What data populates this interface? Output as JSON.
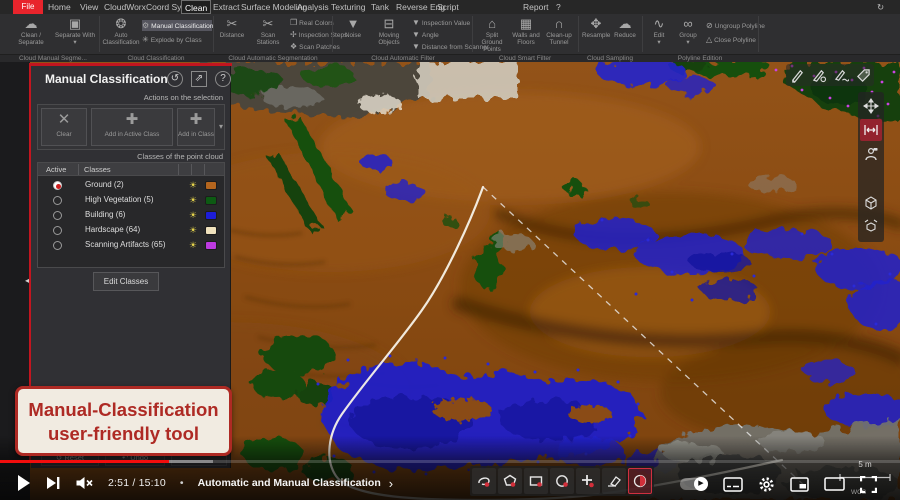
{
  "menu": {
    "file_label": "File",
    "tabs": [
      "Home",
      "View",
      "CloudWorx",
      "Coord Sys",
      "Clean",
      "Extract",
      "Surface Modeling",
      "Analysis",
      "Texturing",
      "Tank",
      "Reverse Eng",
      "Script"
    ],
    "active_tab": "Clean",
    "report_label": "Report",
    "help_label": "?",
    "sync_glyph": "↻"
  },
  "ribbon": {
    "groups": [
      {
        "label": "Cloud Manual Segme...",
        "big": [
          {
            "label": "Clean / Separate",
            "glyph": "☁"
          },
          {
            "label": "Separate With",
            "glyph": "▣",
            "caret": "▾"
          }
        ]
      },
      {
        "label": "Cloud Classification",
        "big": [
          {
            "label": "Auto Classification",
            "glyph": "❂"
          }
        ],
        "small": [
          {
            "label": "Manual Classification",
            "glyph": "⚙"
          },
          {
            "label": "Explode by Class",
            "glyph": "✳"
          }
        ]
      },
      {
        "label": "Cloud Automatic Segmentation",
        "big": [
          {
            "label": "Distance",
            "glyph": "✂"
          },
          {
            "label": "Scan Stations",
            "glyph": "✂"
          }
        ],
        "small": [
          {
            "label": "Real Colors",
            "glyph": "❒"
          },
          {
            "label": "Inspection Steps",
            "glyph": "✢"
          },
          {
            "label": "Scan Patches",
            "glyph": "❖"
          }
        ]
      },
      {
        "label": "Cloud Automatic Filter",
        "big": [
          {
            "label": "Noise",
            "glyph": "▼"
          },
          {
            "label": "Moving Objects",
            "glyph": "⊟"
          }
        ],
        "small": [
          {
            "label": "Inspection Value",
            "glyph": "▼"
          },
          {
            "label": "Angle",
            "glyph": "▼"
          },
          {
            "label": "Distance from Scanner",
            "glyph": "▼"
          }
        ]
      },
      {
        "label": "Cloud Smart Filter",
        "big": [
          {
            "label": "Split Ground Points",
            "glyph": "⌂"
          },
          {
            "label": "Walls and Floors",
            "glyph": "▦"
          },
          {
            "label": "Clean-up Tunnel",
            "glyph": "∩"
          }
        ]
      },
      {
        "label": "Cloud Sampling",
        "big": [
          {
            "label": "Resample",
            "glyph": "✥"
          },
          {
            "label": "Reduce",
            "glyph": "☁"
          }
        ]
      },
      {
        "label": "Polyline Edition",
        "big": [
          {
            "label": "Edit",
            "glyph": "∿",
            "caret": "▾"
          },
          {
            "label": "Group",
            "glyph": "∞",
            "caret": "▾"
          }
        ],
        "small": [
          {
            "label": "Ungroup Polyline",
            "glyph": "⊘"
          },
          {
            "label": "Close Polyline",
            "glyph": "△"
          }
        ]
      }
    ]
  },
  "panel": {
    "title": "Manual Classification",
    "header_icons": {
      "history": "↺",
      "undock": "⇗",
      "help": "?"
    },
    "actions_label": "Actions on the selection",
    "actions": [
      {
        "label": "Clear",
        "glyph": "✕"
      },
      {
        "label": "Add in Active Class",
        "glyph": "✚"
      },
      {
        "label": "Add in Class",
        "glyph": "✚",
        "caret": "▾"
      }
    ],
    "classes_label": "Classes of the point cloud",
    "table": {
      "headers": [
        "Active",
        "Classes"
      ],
      "bulb_glyph": "☀",
      "rows": [
        {
          "label": "Ground (2)",
          "color": "#b4651e",
          "selected": true
        },
        {
          "label": "High Vegetation (5)",
          "color": "#0d5a13"
        },
        {
          "label": "Building (6)",
          "color": "#1d1dd8"
        },
        {
          "label": "Hardscape (64)",
          "color": "#f0e2bd"
        },
        {
          "label": "Scanning Artifacts (65)",
          "color": "#bd3ae0"
        }
      ]
    },
    "edit_button": "Edit Classes",
    "bottom_buttons": [
      {
        "label": "Reset",
        "glyph": "↺"
      },
      {
        "label": "Undo",
        "glyph": "↶"
      },
      {
        "label": "",
        "glyph": ""
      }
    ]
  },
  "caption": {
    "line1": "Manual-Classification",
    "line2": "user-friendly tool"
  },
  "viewport": {
    "scale_label": "5 m",
    "coord_label": "WCS",
    "colors": {
      "ground": "#8f5116",
      "building": "#2121cc",
      "high_vegetation": "#17500f",
      "hardscape": "#d6cdbd",
      "scanning_artifacts": "#c93fe0",
      "selection_line": "#f7f2e8"
    }
  },
  "player": {
    "time": "2:51 / 15:10",
    "separator": "•",
    "chapter": "Automatic and Manual Classification",
    "chevron": "›"
  }
}
